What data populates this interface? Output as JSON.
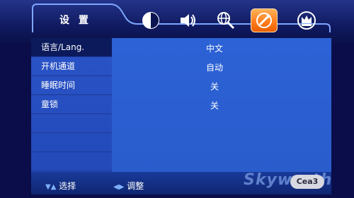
{
  "header": {
    "title": "设 置",
    "icons": [
      {
        "name": "picture-icon"
      },
      {
        "name": "sound-icon"
      },
      {
        "name": "globe-search-icon"
      },
      {
        "name": "settings-tool-icon",
        "active": true
      },
      {
        "name": "crown-icon"
      }
    ]
  },
  "menu": {
    "items": [
      {
        "label": "语言/Lang.",
        "value": "中文",
        "selected": true
      },
      {
        "label": "开机通道",
        "value": "自动"
      },
      {
        "label": "睡眠时间",
        "value": "关"
      },
      {
        "label": "童锁",
        "value": "关"
      }
    ]
  },
  "footer": {
    "select_arrows": "▼▲",
    "select_label": "选择",
    "adjust_arrows": "◀▶",
    "adjust_label": "调整",
    "brand": "Skyworth",
    "watermark": "Cea3"
  },
  "colors": {
    "active_tab": "#ff8a20",
    "panel": "#2a5ccc",
    "selected_row": "#0c1a5c"
  }
}
